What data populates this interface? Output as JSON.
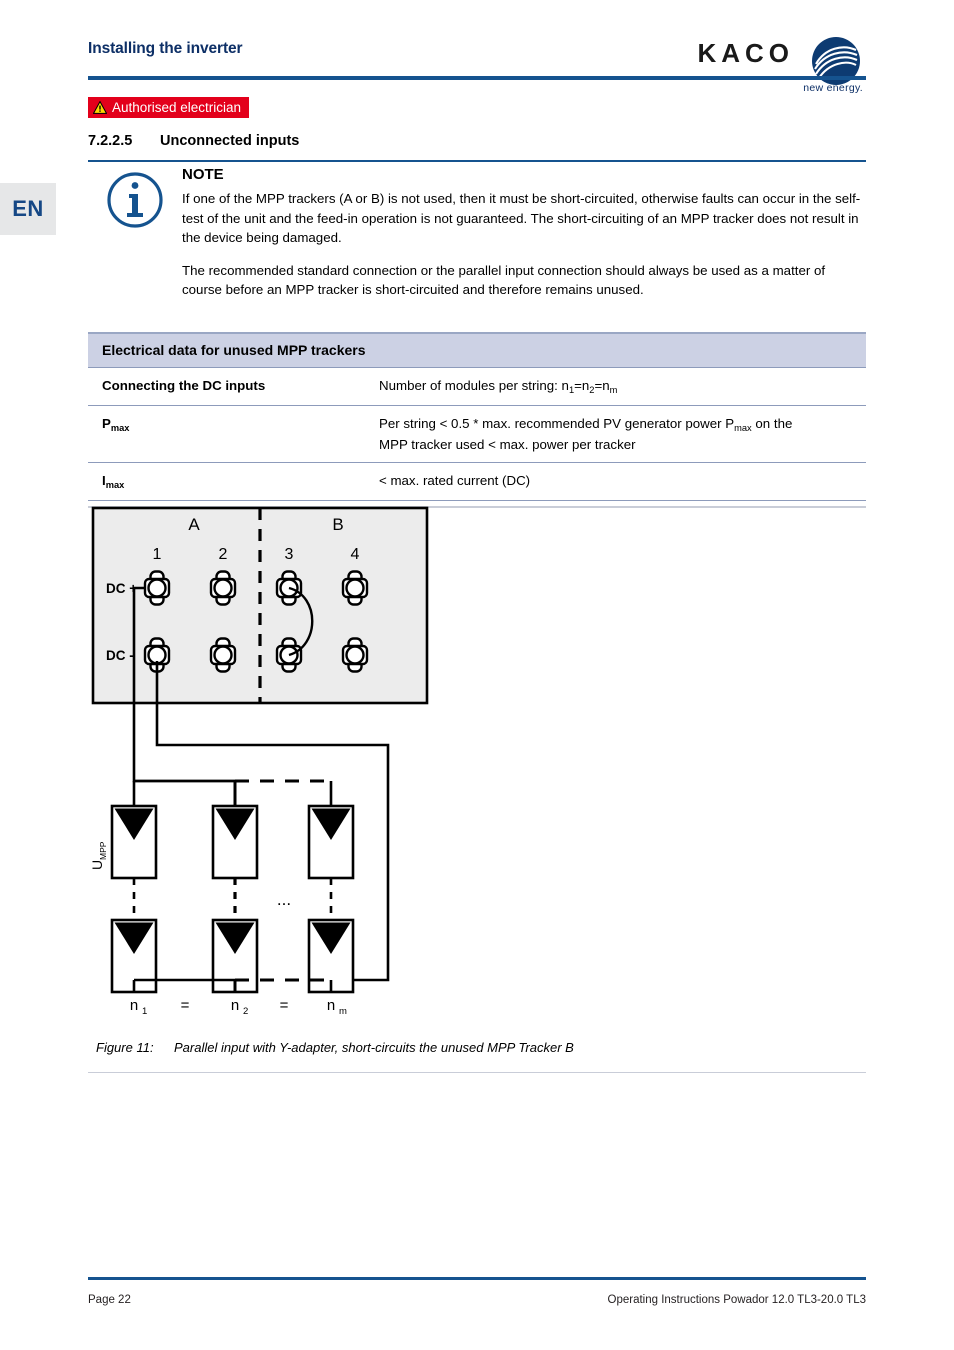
{
  "header": {
    "title": "Installing the inverter",
    "logo_word": "KACO",
    "logo_tagline": "new energy.",
    "logo_icon": "kaco-wave-logo"
  },
  "language_tab": {
    "label": "EN"
  },
  "warning_banner": {
    "icon": "warning-triangle-icon",
    "text": "Authorised electrician",
    "background_color": "#e3001b",
    "text_color": "#ffffff"
  },
  "section": {
    "number": "7.2.2.5",
    "title": "Unconnected inputs"
  },
  "note": {
    "icon": "info-circle-icon",
    "title": "NOTE",
    "paragraphs": [
      "If one of the MPP trackers (A or B) is not used, then it must be short-circuited, otherwise faults can occur in the self-test of the unit and the feed-in operation is not guaranteed. The short-circuiting of an MPP tracker does not result in the device being damaged.",
      "The recommended standard connection or the parallel input connection should always be used as a matter of course before an MPP tracker is short-circuited and therefore remains unused."
    ]
  },
  "table": {
    "header": "Electrical data for unused MPP trackers",
    "header_bg": "#ccd1e4",
    "rows": [
      {
        "label": "Connecting the DC inputs",
        "label_sub": "",
        "value_line1": "Number of modules per string: n",
        "value_sub1": "1",
        "value_mid1": "=n",
        "value_sub2": "2",
        "value_mid2": "=n",
        "value_sub3": "m",
        "value_line2": ""
      },
      {
        "label": "P",
        "label_sub": "max",
        "value_line1": "Per string < 0.5 * max. recommended PV generator power P",
        "value_sub1": "max",
        "value_mid1": " on the",
        "value_line2": "MPP tracker used < max. power per tracker"
      },
      {
        "label": "I",
        "label_sub": "max",
        "value_line1": "< max. rated current (DC)",
        "value_line2": ""
      }
    ]
  },
  "figure": {
    "caption_number": "Figure 11:",
    "caption_text": "Parallel input with Y-adapter, short-circuits the unused MPP Tracker B",
    "tracker_labels": [
      "A",
      "B"
    ],
    "connector_numbers": [
      "1",
      "2",
      "3",
      "4"
    ],
    "row_labels": [
      "DC +",
      "DC -"
    ],
    "voltage_label": "U",
    "voltage_label_sub": "MPP",
    "ellipsis": "...",
    "string_labels": [
      "n",
      "=",
      "n",
      "=",
      "n"
    ],
    "string_subs": [
      "1",
      "2",
      "m"
    ],
    "box_fill": "#ececec"
  },
  "footer": {
    "page": "Page 22",
    "doc_title": "Operating Instructions Powador 12.0 TL3-20.0 TL3"
  }
}
